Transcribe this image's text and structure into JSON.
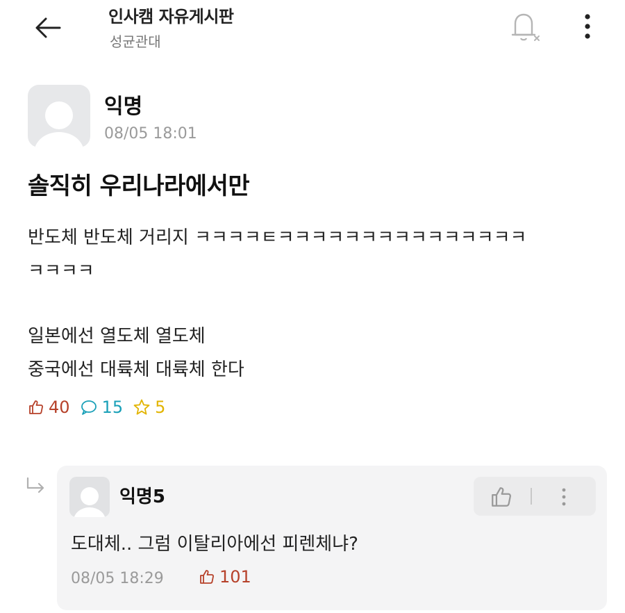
{
  "header": {
    "board_title": "인사캠 자유게시판",
    "school": "성균관대",
    "icons": {
      "back": "back-arrow-icon",
      "notify": "notification-off-bell-icon",
      "more": "more-vertical-icon"
    }
  },
  "post": {
    "author": "익명",
    "datetime": "08/05 18:01",
    "title": "솔직히 우리나라에서만",
    "body_lines": [
      "반도체 반도체 거리지 ㅋㅋㅋㅋㅌㅋㅋㅋㅋㅋㅋㅋㅋㅋㅋㅋㅋㅋㅋㅋ",
      "ㅋㅋㅋㅋ",
      "",
      "일본에선 열도체 열도체",
      "중국에선 대륙체 대륙체 한다"
    ],
    "likes": "40",
    "comments": "15",
    "scraps": "5"
  },
  "comment": {
    "author": "익명5",
    "text": "도대체.. 그럼 이탈리아에선 피렌체냐?",
    "datetime": "08/05 18:29",
    "likes": "101"
  },
  "colors": {
    "like": "#b6412a",
    "comment": "#1aa0b8",
    "scrap": "#e2b400",
    "muted": "#9a9a9a",
    "card_bg": "#f4f4f5"
  }
}
